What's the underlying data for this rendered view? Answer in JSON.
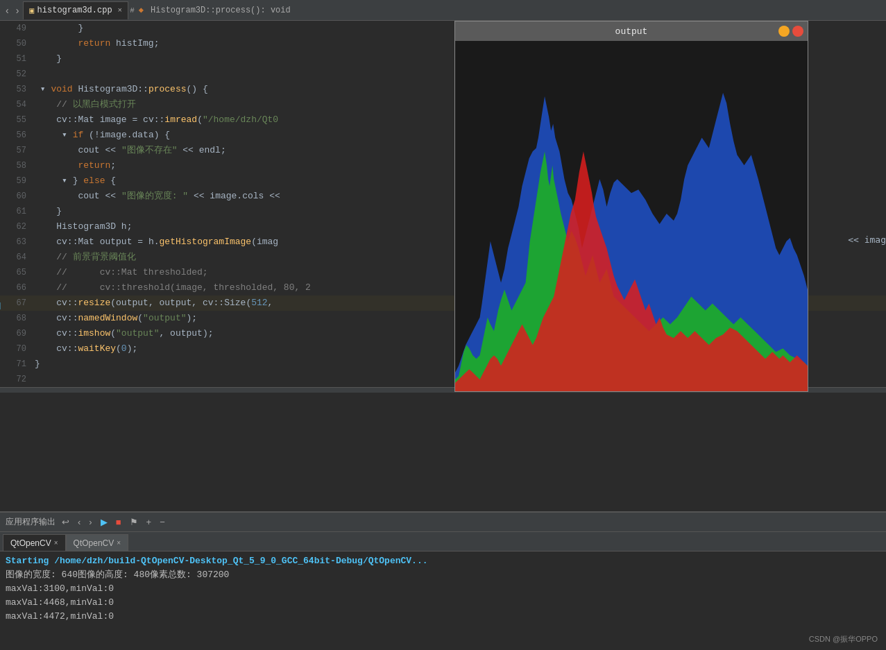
{
  "tabBar": {
    "filename": "histogram3d.cpp",
    "hash": "#",
    "function": "Histogram3D::process(): void",
    "navBack": "<",
    "navFwd": ">"
  },
  "code": {
    "lines": [
      {
        "num": 49,
        "content": "        }"
      },
      {
        "num": 50,
        "content": "        return histImg;"
      },
      {
        "num": 51,
        "content": "    }"
      },
      {
        "num": 52,
        "content": ""
      },
      {
        "num": 53,
        "content": "void Histogram3D::process() {"
      },
      {
        "num": 54,
        "content": "    // 以黑白模式打开"
      },
      {
        "num": 55,
        "content": "    cv::Mat image = cv::imread(\"/home/dzh/Qt0"
      },
      {
        "num": 56,
        "content": "    if (!image.data) {"
      },
      {
        "num": 57,
        "content": "        cout << \"图像不存在\" << endl;"
      },
      {
        "num": 58,
        "content": "        return;"
      },
      {
        "num": 59,
        "content": "    } else {"
      },
      {
        "num": 60,
        "content": "        cout << \"图像的宽度: \" << image.cols <<"
      },
      {
        "num": 61,
        "content": "    }"
      },
      {
        "num": 62,
        "content": "    Histogram3D h;"
      },
      {
        "num": 63,
        "content": "    cv::Mat output = h.getHistogramImage(imag"
      },
      {
        "num": 64,
        "content": "    // 前景背景阈值化"
      },
      {
        "num": 65,
        "content": "//      cv::Mat thresholded;"
      },
      {
        "num": 66,
        "content": "//      cv::threshold(image, thresholded, 80, 2"
      },
      {
        "num": 67,
        "content": "    cv::resize(output, output, cv::Size(512,"
      },
      {
        "num": 68,
        "content": "    cv::namedWindow(\"output\");"
      },
      {
        "num": 69,
        "content": "    cv::imshow(\"output\", output);"
      },
      {
        "num": 70,
        "content": "    cv::waitKey(0);"
      },
      {
        "num": 71,
        "content": "}"
      },
      {
        "num": 72,
        "content": ""
      }
    ]
  },
  "outputWindow": {
    "title": "output",
    "minimizeLabel": "–",
    "closeLabel": "×"
  },
  "bottomPanel": {
    "title": "应用程序输出",
    "tabs": [
      {
        "label": "QtOpenCV",
        "active": true
      },
      {
        "label": "QtOpenCV",
        "active": false
      }
    ],
    "outputLines": [
      {
        "text": "Starting /home/dzh/build-QtOpenCV-Desktop_Qt_5_9_0_GCC_64bit-Debug/QtOpenCV...",
        "type": "blue"
      },
      {
        "text": "图像的宽度: 640图像的高度: 480像素总数: 307200",
        "type": "normal"
      },
      {
        "text": "maxVal:3100,minVal:0",
        "type": "normal"
      },
      {
        "text": "maxVal:4468,minVal:0",
        "type": "normal"
      },
      {
        "text": "maxVal:4472,minVal:0",
        "type": "normal"
      }
    ]
  },
  "watermark": "CSDN @振华OPPO"
}
